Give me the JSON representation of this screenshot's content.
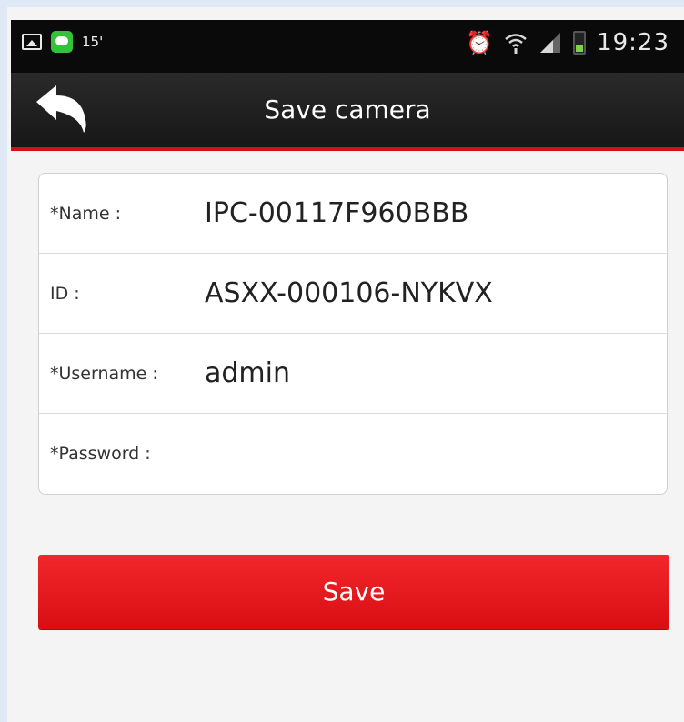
{
  "status_bar": {
    "temperature": "15'",
    "time": "19:23",
    "icons": [
      "image-icon",
      "line-app-icon",
      "alarm-icon",
      "wifi-icon",
      "signal-icon",
      "battery-icon"
    ],
    "battery_color": "#7fd34a"
  },
  "header": {
    "title": "Save camera",
    "back_icon": "back-arrow-icon",
    "accent_color": "#d0111c"
  },
  "form": {
    "fields": [
      {
        "label": "*Name :",
        "value": "IPC-00117F960BBB"
      },
      {
        "label": "ID :",
        "value": "ASXX-000106-NYKVX"
      },
      {
        "label": "*Username :",
        "value": "admin"
      },
      {
        "label": "*Password :",
        "value": ""
      }
    ]
  },
  "actions": {
    "save_label": "Save",
    "save_color": "#e8181c"
  }
}
